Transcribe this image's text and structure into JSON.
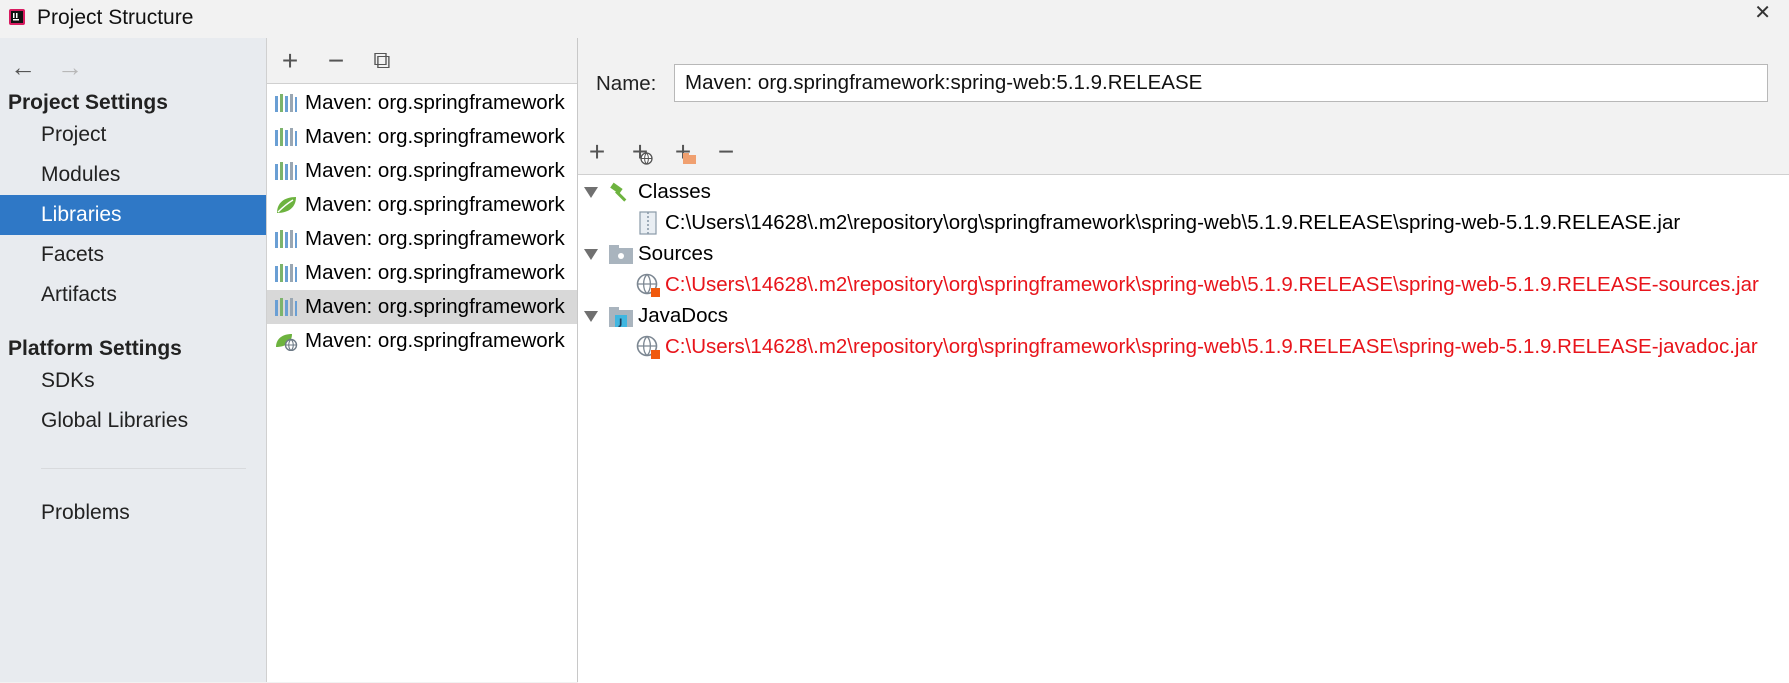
{
  "window": {
    "title": "Project Structure",
    "close": "✕"
  },
  "nav": {
    "back": "←",
    "forward": "→",
    "project_settings": "Project Settings",
    "project_items": [
      "Project",
      "Modules",
      "Libraries",
      "Facets",
      "Artifacts"
    ],
    "platform_settings": "Platform Settings",
    "platform_items": [
      "SDKs",
      "Global Libraries"
    ],
    "problems": "Problems",
    "selected": "Libraries"
  },
  "libraries": {
    "toolbar": {
      "add": "+",
      "remove": "−",
      "copy": "⧉"
    },
    "items": [
      {
        "label": "Maven: org.springframework",
        "icon": "maven-library-icon"
      },
      {
        "label": "Maven: org.springframework",
        "icon": "maven-library-icon"
      },
      {
        "label": "Maven: org.springframework",
        "icon": "maven-library-icon"
      },
      {
        "label": "Maven: org.springframework",
        "icon": "spring-leaf-icon"
      },
      {
        "label": "Maven: org.springframework",
        "icon": "maven-library-icon"
      },
      {
        "label": "Maven: org.springframework",
        "icon": "maven-library-icon"
      },
      {
        "label": "Maven: org.springframework",
        "icon": "maven-library-icon",
        "selected": true
      },
      {
        "label": "Maven: org.springframework",
        "icon": "spring-web-icon"
      }
    ]
  },
  "detail": {
    "name_label": "Name:",
    "name_value": "Maven: org.springframework:spring-web:5.1.9.RELEASE",
    "toolbar": {
      "add": "+",
      "add_url": "+",
      "add_excluded": "+",
      "remove": "−"
    },
    "tree": {
      "classes_label": "Classes",
      "classes_path": "C:\\Users\\14628\\.m2\\repository\\org\\springframework\\spring-web\\5.1.9.RELEASE\\spring-web-5.1.9.RELEASE.jar",
      "sources_label": "Sources",
      "sources_path": "C:\\Users\\14628\\.m2\\repository\\org\\springframework\\spring-web\\5.1.9.RELEASE\\spring-web-5.1.9.RELEASE-sources.jar",
      "javadocs_label": "JavaDocs",
      "javadocs_path": "C:\\Users\\14628\\.m2\\repository\\org\\springframework\\spring-web\\5.1.9.RELEASE\\spring-web-5.1.9.RELEASE-javadoc.jar"
    }
  },
  "colors": {
    "selection_blue": "#2f78c6",
    "missing_red": "#e8141b",
    "nav_bg": "#e8ebef"
  }
}
